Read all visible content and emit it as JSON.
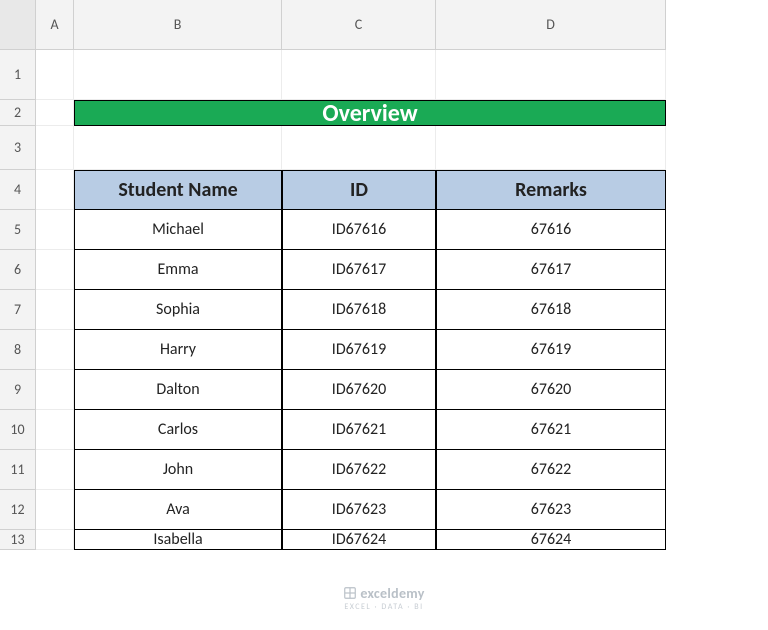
{
  "columns": [
    "A",
    "B",
    "C",
    "D"
  ],
  "rows": [
    "1",
    "2",
    "3",
    "4",
    "5",
    "6",
    "7",
    "8",
    "9",
    "10",
    "11",
    "12",
    "13"
  ],
  "title": "Overview",
  "headers": {
    "b": "Student Name",
    "c": "ID",
    "d": "Remarks"
  },
  "table": [
    {
      "name": "Michael",
      "id": "ID67616",
      "remarks": "67616"
    },
    {
      "name": "Emma",
      "id": "ID67617",
      "remarks": "67617"
    },
    {
      "name": "Sophia",
      "id": "ID67618",
      "remarks": "67618"
    },
    {
      "name": "Harry",
      "id": "ID67619",
      "remarks": "67619"
    },
    {
      "name": "Dalton",
      "id": "ID67620",
      "remarks": "67620"
    },
    {
      "name": "Carlos",
      "id": "ID67621",
      "remarks": "67621"
    },
    {
      "name": "John",
      "id": "ID67622",
      "remarks": "67622"
    },
    {
      "name": "Ava",
      "id": "ID67623",
      "remarks": "67623"
    },
    {
      "name": "Isabella",
      "id": "ID67624",
      "remarks": "67624"
    }
  ],
  "watermark": {
    "brand": "exceldemy",
    "tagline": "EXCEL · DATA · BI"
  }
}
